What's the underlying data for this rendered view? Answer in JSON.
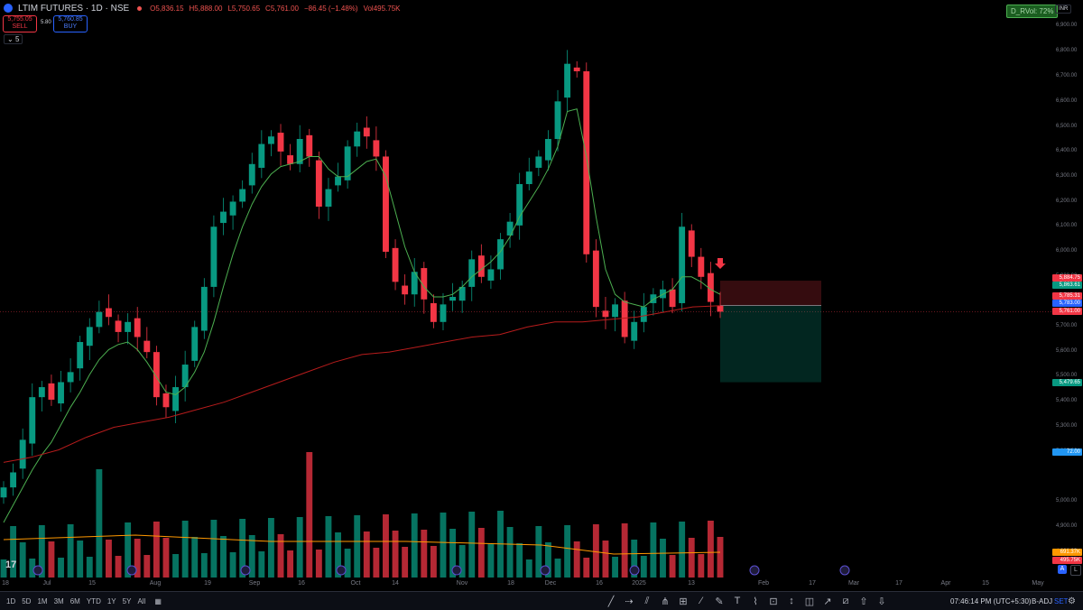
{
  "header": {
    "symbol": "LTIM FUTURES · 1D · NSE",
    "ohlc_o": "O5,836.15",
    "ohlc_h": "H5,888.00",
    "ohlc_l": "L5,750.65",
    "ohlc_c": "C5,761.00",
    "change": "−86.45 (−1.48%)",
    "volume": "Vol495.75K",
    "sell_price": "5,755.05",
    "sell_label": "SELL",
    "spread": "5.80",
    "buy_price": "5,760.85",
    "buy_label": "BUY",
    "indicator_count": "5",
    "currency": "INR",
    "rvol_badge": "D_RVol: 72%"
  },
  "price_axis": {
    "labels": [
      "6,900.00",
      "6,800.00",
      "6,700.00",
      "6,600.00",
      "6,500.00",
      "6,400.00",
      "6,300.00",
      "6,200.00",
      "6,100.00",
      "6,000.00",
      "5,900.00",
      "5,700.00",
      "5,600.00",
      "5,500.00",
      "5,400.00",
      "5,300.00",
      "5,200.00",
      "5,000.00",
      "4,900.00",
      "4,800.00"
    ],
    "tags": [
      {
        "text": "5,884.75",
        "color": "#f23645"
      },
      {
        "text": "5,863.61",
        "color": "#089981"
      },
      {
        "text": "5,785.31",
        "color": "#f23645"
      },
      {
        "text": "5,783.00",
        "color": "#2962ff"
      },
      {
        "text": "5,761.00",
        "color": "#f23645"
      },
      {
        "text": "5,479.65",
        "color": "#089981"
      },
      {
        "text": "72.00",
        "color": "#2196f3"
      },
      {
        "text": "691.37K",
        "color": "#ff9800"
      },
      {
        "text": "495.75K",
        "color": "#f23645"
      }
    ]
  },
  "time_axis": [
    "18",
    "Jul",
    "15",
    "Aug",
    "19",
    "Sep",
    "16",
    "Oct",
    "14",
    "Nov",
    "18",
    "Dec",
    "16",
    "2025",
    "13",
    "Feb",
    "17",
    "Mar",
    "17",
    "Apr",
    "15",
    "May"
  ],
  "bottom_bar": {
    "timeframes": [
      "1D",
      "5D",
      "1M",
      "3M",
      "6M",
      "YTD",
      "1Y",
      "5Y",
      "All"
    ],
    "clock": "07:46:14 PM (UTC+5:30)",
    "adjust": "B-ADJ",
    "settlement": "SET",
    "auto_label": "A",
    "log_label": "L"
  },
  "tools": [
    "trend-line",
    "ray",
    "parallel-channel",
    "pitchfork",
    "gann-box",
    "fib",
    "brush",
    "text",
    "pattern",
    "long-position",
    "measure",
    "note",
    "arrow-mark",
    "forecast",
    "arrow-up",
    "arrow-down"
  ],
  "colors": {
    "up": "#089981",
    "down": "#f23645",
    "ma_fast": "#4caf50",
    "ma_slow": "#b71c1c",
    "vol_ma": "#ff9800",
    "accent": "#2962ff"
  },
  "chart_data": {
    "type": "candlestick",
    "title": "LTIM FUTURES · 1D · NSE",
    "ylim": [
      4700,
      6930
    ],
    "price_closes": [
      5060,
      5120,
      5250,
      5420,
      5460,
      5410,
      5480,
      5520,
      5640,
      5700,
      5760,
      5740,
      5680,
      5720,
      5660,
      5600,
      5420,
      5380,
      5460,
      5550,
      5700,
      5860,
      6100,
      6160,
      6200,
      6250,
      6350,
      6430,
      6460,
      6400,
      6350,
      6450,
      6380,
      6180,
      6250,
      6300,
      6420,
      6480,
      6460,
      6380,
      6000,
      5880,
      5830,
      5920,
      5810,
      5720,
      5790,
      5820,
      5860,
      5970,
      5900,
      5930,
      6050,
      6120,
      6270,
      6320,
      6380,
      6450,
      6600,
      6750,
      6720,
      5990,
      5780,
      5740,
      5790,
      5660,
      5720,
      5780,
      5830,
      5850,
      5780,
      6100,
      5980,
      5900,
      5800,
      5761
    ],
    "sma_20": [
      4920,
      4990,
      5060,
      5130,
      5190,
      5240,
      5310,
      5380,
      5440,
      5510,
      5570,
      5610,
      5630,
      5640,
      5610,
      5560,
      5500,
      5440,
      5430,
      5460,
      5520,
      5600,
      5720,
      5860,
      5990,
      6100,
      6190,
      6260,
      6310,
      6340,
      6350,
      6360,
      6380,
      6380,
      6330,
      6300,
      6300,
      6330,
      6360,
      6370,
      6300,
      6160,
      6020,
      5920,
      5860,
      5820,
      5820,
      5830,
      5860,
      5900,
      5930,
      5960,
      6000,
      6060,
      6140,
      6200,
      6260,
      6330,
      6420,
      6560,
      6570,
      6380,
      6140,
      5930,
      5830,
      5800,
      5790,
      5780,
      5810,
      5830,
      5850,
      5900,
      5900,
      5880,
      5850,
      5830
    ],
    "sma_200": [
      5160,
      5180,
      5210,
      5260,
      5300,
      5320,
      5340,
      5370,
      5400,
      5440,
      5480,
      5520,
      5560,
      5590,
      5600,
      5620,
      5640,
      5660,
      5670,
      5700,
      5720,
      5720,
      5730,
      5740,
      5760,
      5780,
      5785
    ],
    "volume_ma": "691.37K",
    "last_volume": "495.75K",
    "rvol_percent": 72,
    "position": {
      "type": "short",
      "entry": 5785.31,
      "stop": 5884.75,
      "target": 5479.65
    }
  }
}
